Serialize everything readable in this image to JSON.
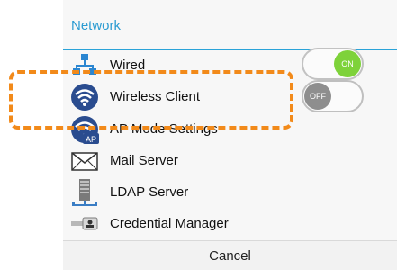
{
  "dialog": {
    "title": "Network",
    "items": [
      {
        "label": "Wired",
        "icon": "wired-network-icon"
      },
      {
        "label": "Wireless Client",
        "icon": "wireless-icon"
      },
      {
        "label": "AP Mode Settings",
        "icon": "ap-mode-icon",
        "badge": "AP"
      },
      {
        "label": "Mail Server",
        "icon": "mail-icon"
      },
      {
        "label": "LDAP Server",
        "icon": "server-icon"
      },
      {
        "label": "Credential Manager",
        "icon": "credential-icon"
      }
    ],
    "cancel_label": "Cancel"
  },
  "toggles": {
    "wired": {
      "state": "ON"
    },
    "wireless": {
      "state": "OFF"
    }
  },
  "colors": {
    "title": "#2b9bd1",
    "divider": "#2aa3d8",
    "toggle_on": "#7ed23a",
    "toggle_off": "#8e8e8e",
    "callout": "#f28a1a"
  }
}
